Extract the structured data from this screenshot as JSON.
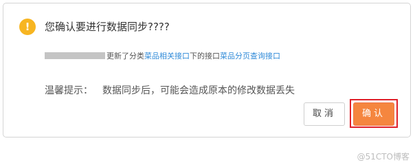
{
  "dialog": {
    "icon": "warning-icon",
    "icon_glyph": "!",
    "title": "您确认要进行数据同步????",
    "info": {
      "updated_text": "更新了分类",
      "category_link": "菜品相关接口",
      "under_text": "下的接口",
      "api_link": "菜品分页查询接口"
    },
    "hint_label": "温馨提示：",
    "hint_text": "数据同步后，可能会造成原本的修改数据丢失",
    "buttons": {
      "cancel": "取消",
      "confirm": "确认"
    }
  },
  "watermark": "@51CTO博客",
  "colors": {
    "warning": "#f7b521",
    "link": "#2f8ad8",
    "confirm": "#f5863f",
    "highlight_outline": "#e0202a"
  }
}
